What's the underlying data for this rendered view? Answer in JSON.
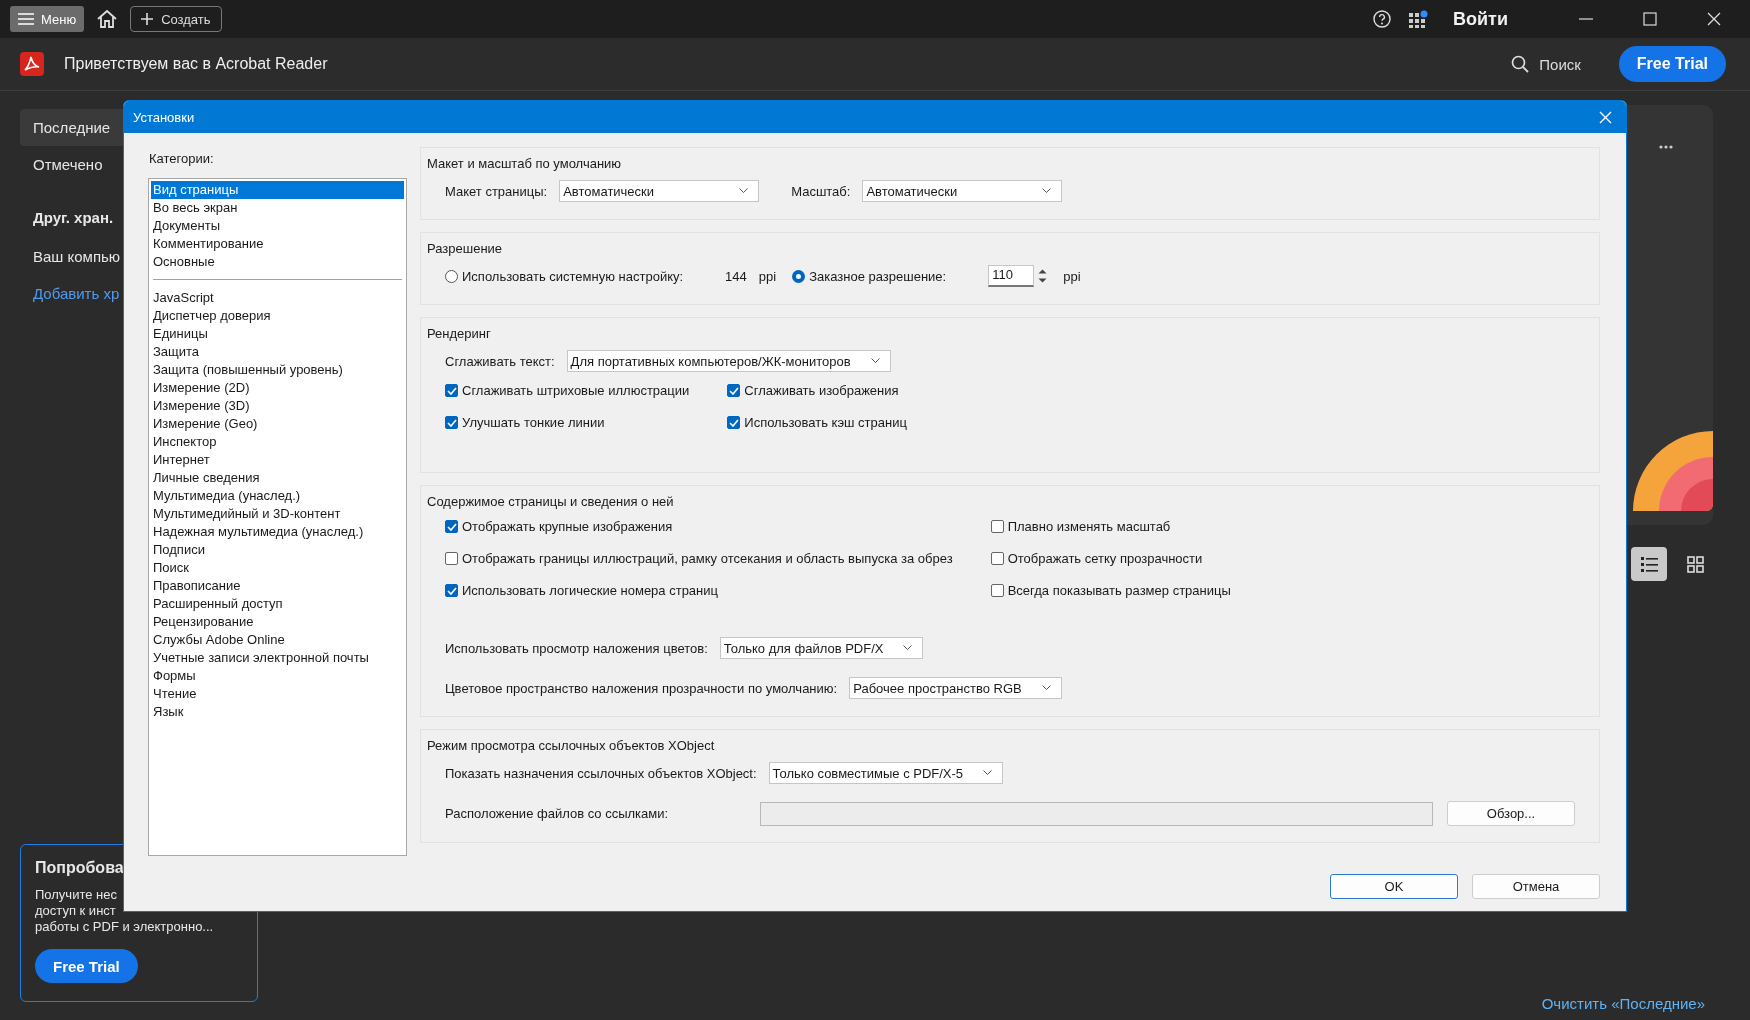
{
  "top_bar": {
    "menu": "Меню",
    "create": "Создать",
    "sign_in": "Войти"
  },
  "header": {
    "title": "Приветствуем вас в Acrobat Reader",
    "search": "Поиск",
    "trial": "Free Trial"
  },
  "sidebar": {
    "items": [
      {
        "label": "Последние",
        "selected": true
      },
      {
        "label": "Отмечено",
        "selected": false
      }
    ],
    "storage_heading": "Друг. хран.",
    "storage_items": [
      {
        "label": "Ваш компью",
        "kind": "item"
      },
      {
        "label": "Добавить хр",
        "kind": "link"
      }
    ]
  },
  "promo": {
    "title": "Попробова",
    "lines": [
      "Получите нес",
      "доступ к инст",
      "работы с PDF и электронно..."
    ],
    "button": "Free Trial"
  },
  "view_toggle": [
    {
      "kind": "list",
      "selected": true
    },
    {
      "kind": "grid",
      "selected": false
    }
  ],
  "clear_recent": "Очистить «Последние»",
  "dialog": {
    "title": "Установки",
    "categories_label": "Категории:",
    "category_groups": [
      {
        "items": [
          {
            "label": "Вид страницы",
            "selected": true
          },
          {
            "label": "Во весь экран",
            "selected": false
          },
          {
            "label": "Документы",
            "selected": false
          },
          {
            "label": "Комментирование",
            "selected": false
          },
          {
            "label": "Основные",
            "selected": false
          }
        ]
      },
      {
        "items": [
          {
            "label": "JavaScript",
            "selected": false
          },
          {
            "label": "Диспетчер доверия",
            "selected": false
          },
          {
            "label": "Единицы",
            "selected": false
          },
          {
            "label": "Защита",
            "selected": false
          },
          {
            "label": "Защита (повышенный уровень)",
            "selected": false
          },
          {
            "label": "Измерение (2D)",
            "selected": false
          },
          {
            "label": "Измерение (3D)",
            "selected": false
          },
          {
            "label": "Измерение (Geo)",
            "selected": false
          },
          {
            "label": "Инспектор",
            "selected": false
          },
          {
            "label": "Интернет",
            "selected": false
          },
          {
            "label": "Личные сведения",
            "selected": false
          },
          {
            "label": "Мультимедиа (унаслед.)",
            "selected": false
          },
          {
            "label": "Мультимедийный и 3D-контент",
            "selected": false
          },
          {
            "label": "Надежная мультимедиа (унаслед.)",
            "selected": false
          },
          {
            "label": "Подписи",
            "selected": false
          },
          {
            "label": "Поиск",
            "selected": false
          },
          {
            "label": "Правописание",
            "selected": false
          },
          {
            "label": "Расширенный доступ",
            "selected": false
          },
          {
            "label": "Рецензирование",
            "selected": false
          },
          {
            "label": "Службы Adobe Online",
            "selected": false
          },
          {
            "label": "Учетные записи электронной почты",
            "selected": false
          },
          {
            "label": "Формы",
            "selected": false
          },
          {
            "label": "Чтение",
            "selected": false
          },
          {
            "label": "Язык",
            "selected": false
          }
        ]
      }
    ],
    "sections": [
      {
        "title": "Макет и масштаб по умолчанию",
        "blocks": [
          {
            "kind": "row",
            "parts": [
              {
                "kind": "label",
                "text": "Макет страницы:"
              },
              {
                "kind": "select",
                "value": "Автоматически"
              },
              {
                "kind": "label",
                "text": "Масштаб:"
              },
              {
                "kind": "select",
                "value": "Автоматически"
              }
            ]
          }
        ]
      },
      {
        "title": "Разрешение",
        "blocks": [
          {
            "kind": "row",
            "parts": [
              {
                "kind": "radio",
                "label": "Использовать системную настройку:",
                "selected": false
              },
              {
                "kind": "text",
                "text": "144"
              },
              {
                "kind": "text",
                "text": "ppi"
              },
              {
                "kind": "radio",
                "label": "Заказное разрешение:",
                "selected": true
              },
              {
                "kind": "spin",
                "value": "110"
              },
              {
                "kind": "text",
                "text": "ppi"
              }
            ]
          }
        ]
      },
      {
        "title": "Рендеринг",
        "blocks": [
          {
            "kind": "row",
            "parts": [
              {
                "kind": "label",
                "text": "Сглаживать текст:"
              },
              {
                "kind": "select",
                "value": "Для портативных компьютеров/ЖК-мониторов"
              }
            ]
          },
          {
            "kind": "checks",
            "columns": [
              [
                {
                  "label": "Сглаживать штриховые иллюстрации",
                  "checked": true
                },
                {
                  "label": "Улучшать тонкие линии",
                  "checked": true
                }
              ],
              [
                {
                  "label": "Сглаживать изображения",
                  "checked": true
                },
                {
                  "label": "Использовать кэш страниц",
                  "checked": true
                }
              ]
            ]
          }
        ]
      },
      {
        "title": "Содержимое страницы и сведения о ней",
        "blocks": [
          {
            "kind": "checks",
            "columns": [
              [
                {
                  "label": "Отображать крупные изображения",
                  "checked": true
                },
                {
                  "label": "Отображать границы иллюстраций, рамку отсекания и область выпуска за обрез",
                  "checked": false
                },
                {
                  "label": "Использовать логические номера страниц",
                  "checked": true
                }
              ],
              [
                {
                  "label": "Плавно изменять масштаб",
                  "checked": false
                },
                {
                  "label": "Отображать сетку прозрачности",
                  "checked": false
                },
                {
                  "label": "Всегда показывать размер страницы",
                  "checked": false
                }
              ]
            ]
          },
          {
            "kind": "row",
            "parts": [
              {
                "kind": "label",
                "text": "Использовать просмотр наложения цветов:"
              },
              {
                "kind": "select",
                "value": "Только для файлов PDF/X"
              }
            ]
          },
          {
            "kind": "row",
            "parts": [
              {
                "kind": "label",
                "text": "Цветовое пространство наложения прозрачности по умолчанию:"
              },
              {
                "kind": "select",
                "value": "Рабочее пространство RGB"
              }
            ]
          }
        ]
      },
      {
        "title": "Режим просмотра ссылочных объектов XObject",
        "blocks": [
          {
            "kind": "row",
            "parts": [
              {
                "kind": "label",
                "text": "Показать назначения ссылочных объектов XObject:"
              },
              {
                "kind": "select",
                "value": "Только совместимые с PDF/X-5"
              }
            ]
          },
          {
            "kind": "row",
            "parts": [
              {
                "kind": "label",
                "text": "Расположение файлов со ссылками:"
              },
              {
                "kind": "path"
              },
              {
                "kind": "button",
                "label": "Обзор..."
              }
            ]
          }
        ]
      }
    ],
    "buttons": [
      {
        "label": "OK",
        "default": true
      },
      {
        "label": "Отмена",
        "default": false
      }
    ]
  }
}
